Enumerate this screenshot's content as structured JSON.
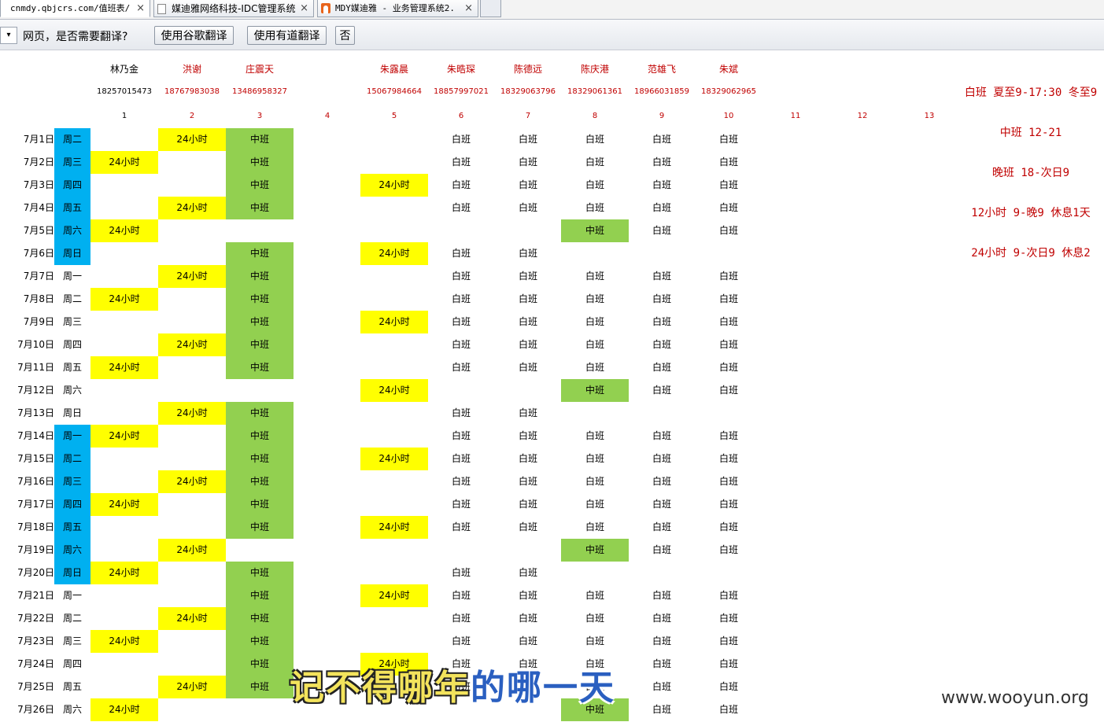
{
  "tabs": [
    {
      "title": "cnmdy.qbjcrs.com/值班表/",
      "close": "×",
      "active": true
    },
    {
      "title": "媒迪雅网络科技-IDC管理系统",
      "close": "×",
      "active": false
    },
    {
      "title": "MDY媒迪雅 - 业务管理系统2.",
      "close": "×",
      "active": false
    }
  ],
  "translate_bar": {
    "dropdown": "▾",
    "prompt": "网页，是否需要翻译?",
    "google_button": "使用谷歌翻译",
    "youdao_button": "使用有道翻译",
    "no_button": "否"
  },
  "staff": [
    {
      "name": "林乃金",
      "phone": "18257015473",
      "number": "1",
      "color": "#000000"
    },
    {
      "name": "洪谢",
      "phone": "18767983038",
      "number": "2",
      "color": "#c00000"
    },
    {
      "name": "庄震天",
      "phone": "13486958327",
      "number": "3",
      "color": "#c00000"
    },
    {
      "name": "",
      "phone": "",
      "number": "4",
      "color": "#c00000"
    },
    {
      "name": "朱露晨",
      "phone": "15067984664",
      "number": "5",
      "color": "#c00000"
    },
    {
      "name": "朱晧琛",
      "phone": "18857997021",
      "number": "6",
      "color": "#c00000"
    },
    {
      "name": "陈德远",
      "phone": "18329063796",
      "number": "7",
      "color": "#c00000"
    },
    {
      "name": "陈庆港",
      "phone": "18329061361",
      "number": "8",
      "color": "#c00000"
    },
    {
      "name": "范雄飞",
      "phone": "18966031859",
      "number": "9",
      "color": "#c00000"
    },
    {
      "name": "朱斌",
      "phone": "18329062965",
      "number": "10",
      "color": "#c00000"
    },
    {
      "name": "",
      "phone": "",
      "number": "11",
      "color": "#c00000"
    },
    {
      "name": "",
      "phone": "",
      "number": "12",
      "color": "#c00000"
    },
    {
      "name": "",
      "phone": "",
      "number": "13",
      "color": "#c00000"
    }
  ],
  "legend": [
    "白班 夏至9-17:30 冬至9",
    "中班 12-21",
    "晚班 18-次日9",
    "12小时 9-晚9 休息1天",
    "24小时 9-次日9 休息2"
  ],
  "shift_colors": {
    "24小时": "#ffff00",
    "中班": "#92d050",
    "weekday_highlight": "#00b0f0"
  },
  "rows": [
    {
      "date": "7月1日",
      "weekday": "周二",
      "hl": true,
      "shifts": [
        "",
        "24小时",
        "中班",
        "",
        "",
        "白班",
        "白班",
        "白班",
        "白班",
        "白班"
      ]
    },
    {
      "date": "7月2日",
      "weekday": "周三",
      "hl": true,
      "shifts": [
        "24小时",
        "",
        "中班",
        "",
        "",
        "白班",
        "白班",
        "白班",
        "白班",
        "白班"
      ]
    },
    {
      "date": "7月3日",
      "weekday": "周四",
      "hl": true,
      "shifts": [
        "",
        "",
        "中班",
        "",
        "24小时",
        "白班",
        "白班",
        "白班",
        "白班",
        "白班"
      ]
    },
    {
      "date": "7月4日",
      "weekday": "周五",
      "hl": true,
      "shifts": [
        "",
        "24小时",
        "中班",
        "",
        "",
        "白班",
        "白班",
        "白班",
        "白班",
        "白班"
      ]
    },
    {
      "date": "7月5日",
      "weekday": "周六",
      "hl": true,
      "shifts": [
        "24小时",
        "",
        "",
        "",
        "",
        "",
        "",
        "中班",
        "白班",
        "白班"
      ]
    },
    {
      "date": "7月6日",
      "weekday": "周日",
      "hl": true,
      "shifts": [
        "",
        "",
        "中班",
        "",
        "24小时",
        "白班",
        "白班",
        "",
        "",
        ""
      ]
    },
    {
      "date": "7月7日",
      "weekday": "周一",
      "hl": false,
      "shifts": [
        "",
        "24小时",
        "中班",
        "",
        "",
        "白班",
        "白班",
        "白班",
        "白班",
        "白班"
      ]
    },
    {
      "date": "7月8日",
      "weekday": "周二",
      "hl": false,
      "shifts": [
        "24小时",
        "",
        "中班",
        "",
        "",
        "白班",
        "白班",
        "白班",
        "白班",
        "白班"
      ]
    },
    {
      "date": "7月9日",
      "weekday": "周三",
      "hl": false,
      "shifts": [
        "",
        "",
        "中班",
        "",
        "24小时",
        "白班",
        "白班",
        "白班",
        "白班",
        "白班"
      ]
    },
    {
      "date": "7月10日",
      "weekday": "周四",
      "hl": false,
      "shifts": [
        "",
        "24小时",
        "中班",
        "",
        "",
        "白班",
        "白班",
        "白班",
        "白班",
        "白班"
      ]
    },
    {
      "date": "7月11日",
      "weekday": "周五",
      "hl": false,
      "shifts": [
        "24小时",
        "",
        "中班",
        "",
        "",
        "白班",
        "白班",
        "白班",
        "白班",
        "白班"
      ]
    },
    {
      "date": "7月12日",
      "weekday": "周六",
      "hl": false,
      "shifts": [
        "",
        "",
        "",
        "",
        "24小时",
        "",
        "",
        "中班",
        "白班",
        "白班"
      ]
    },
    {
      "date": "7月13日",
      "weekday": "周日",
      "hl": false,
      "shifts": [
        "",
        "24小时",
        "中班",
        "",
        "",
        "白班",
        "白班",
        "",
        "",
        ""
      ]
    },
    {
      "date": "7月14日",
      "weekday": "周一",
      "hl": true,
      "shifts": [
        "24小时",
        "",
        "中班",
        "",
        "",
        "白班",
        "白班",
        "白班",
        "白班",
        "白班"
      ]
    },
    {
      "date": "7月15日",
      "weekday": "周二",
      "hl": true,
      "shifts": [
        "",
        "",
        "中班",
        "",
        "24小时",
        "白班",
        "白班",
        "白班",
        "白班",
        "白班"
      ]
    },
    {
      "date": "7月16日",
      "weekday": "周三",
      "hl": true,
      "shifts": [
        "",
        "24小时",
        "中班",
        "",
        "",
        "白班",
        "白班",
        "白班",
        "白班",
        "白班"
      ]
    },
    {
      "date": "7月17日",
      "weekday": "周四",
      "hl": true,
      "shifts": [
        "24小时",
        "",
        "中班",
        "",
        "",
        "白班",
        "白班",
        "白班",
        "白班",
        "白班"
      ]
    },
    {
      "date": "7月18日",
      "weekday": "周五",
      "hl": true,
      "shifts": [
        "",
        "",
        "中班",
        "",
        "24小时",
        "白班",
        "白班",
        "白班",
        "白班",
        "白班"
      ]
    },
    {
      "date": "7月19日",
      "weekday": "周六",
      "hl": true,
      "shifts": [
        "",
        "24小时",
        "",
        "",
        "",
        "",
        "",
        "中班",
        "白班",
        "白班"
      ]
    },
    {
      "date": "7月20日",
      "weekday": "周日",
      "hl": true,
      "shifts": [
        "24小时",
        "",
        "中班",
        "",
        "",
        "白班",
        "白班",
        "",
        "",
        ""
      ]
    },
    {
      "date": "7月21日",
      "weekday": "周一",
      "hl": false,
      "shifts": [
        "",
        "",
        "中班",
        "",
        "24小时",
        "白班",
        "白班",
        "白班",
        "白班",
        "白班"
      ]
    },
    {
      "date": "7月22日",
      "weekday": "周二",
      "hl": false,
      "shifts": [
        "",
        "24小时",
        "中班",
        "",
        "",
        "白班",
        "白班",
        "白班",
        "白班",
        "白班"
      ]
    },
    {
      "date": "7月23日",
      "weekday": "周三",
      "hl": false,
      "shifts": [
        "24小时",
        "",
        "中班",
        "",
        "",
        "白班",
        "白班",
        "白班",
        "白班",
        "白班"
      ]
    },
    {
      "date": "7月24日",
      "weekday": "周四",
      "hl": false,
      "shifts": [
        "",
        "",
        "中班",
        "",
        "24小时",
        "白班",
        "白班",
        "白班",
        "白班",
        "白班"
      ]
    },
    {
      "date": "7月25日",
      "weekday": "周五",
      "hl": false,
      "shifts": [
        "",
        "24小时",
        "中班",
        "",
        "",
        "白班",
        "白班",
        "白班",
        "白班",
        "白班"
      ]
    },
    {
      "date": "7月26日",
      "weekday": "周六",
      "hl": false,
      "shifts": [
        "24小时",
        "",
        "",
        "",
        "",
        "",
        "",
        "中班",
        "白班",
        "白班"
      ]
    }
  ],
  "caption": {
    "part1": "记不得哪年",
    "part2": "的哪一天"
  },
  "watermark": "www.wooyun.org"
}
